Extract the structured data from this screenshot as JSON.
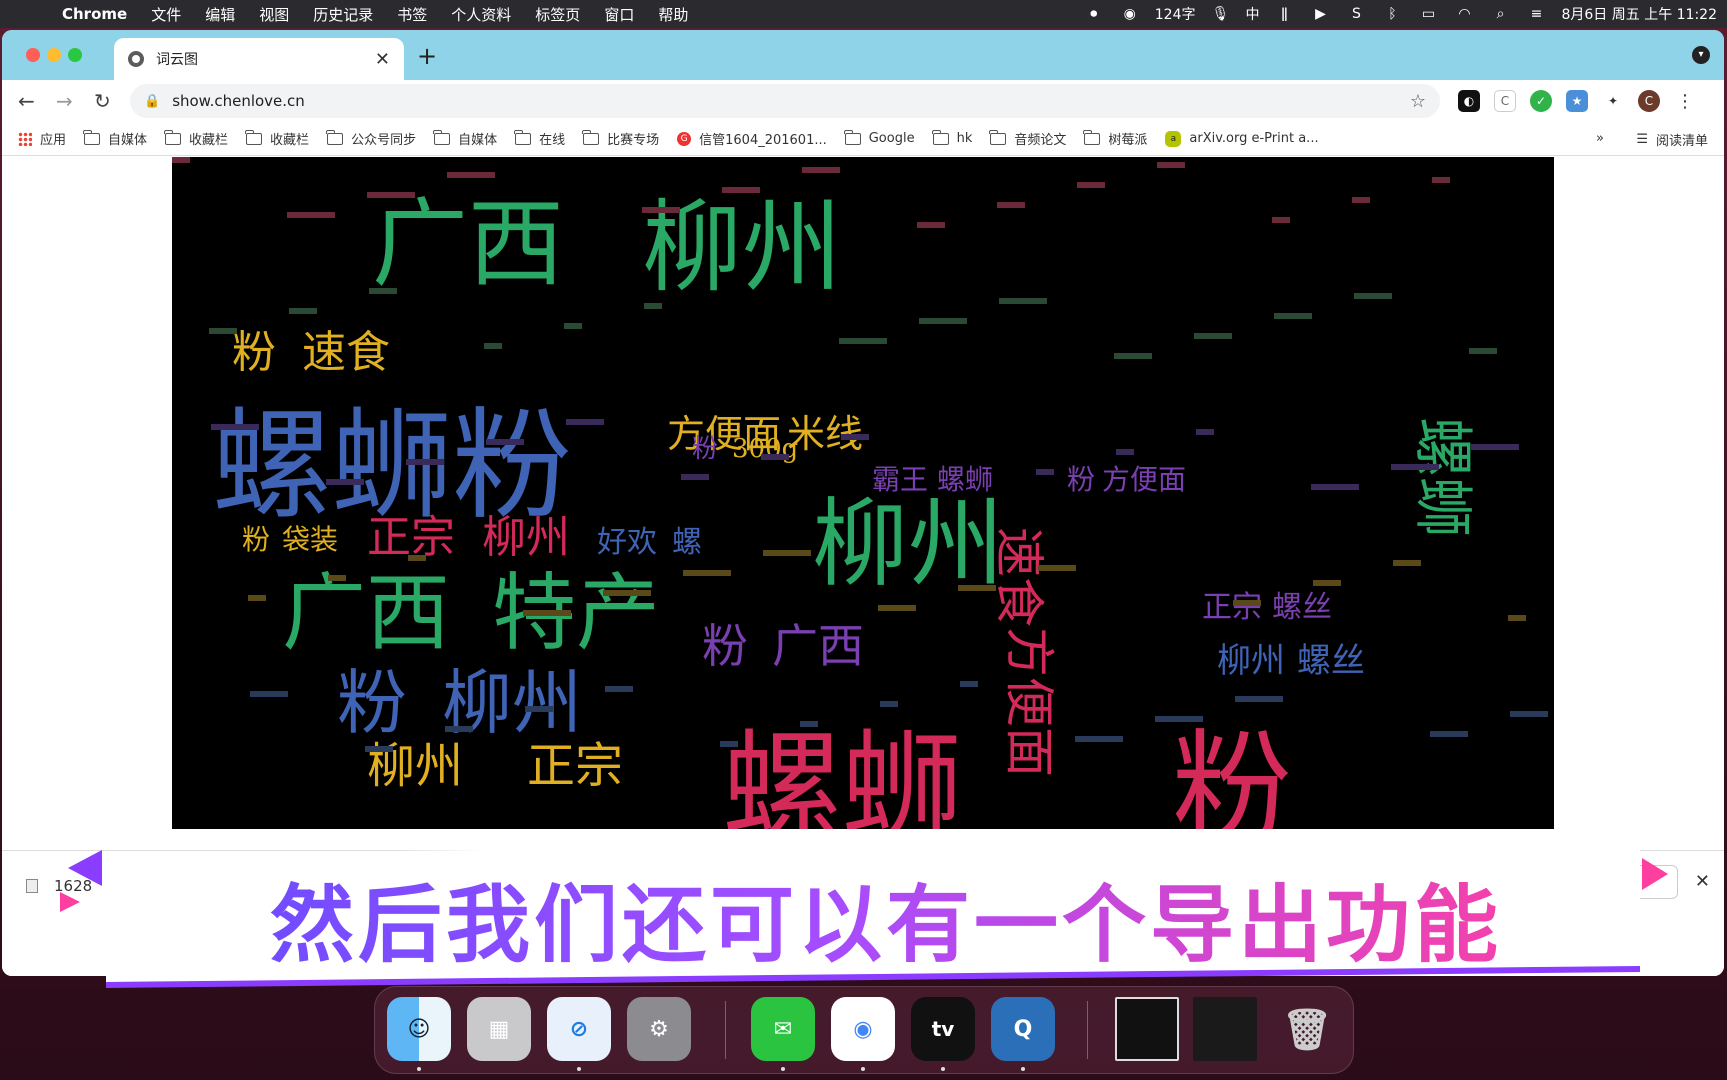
{
  "menubar": {
    "app": "Chrome",
    "items": [
      "文件",
      "编辑",
      "视图",
      "历史记录",
      "书签",
      "个人资料",
      "标签页",
      "窗口",
      "帮助"
    ],
    "status": {
      "word_count": "124字",
      "input_method": "中",
      "datetime": "8月6日 周五 上午 11:22"
    }
  },
  "browser": {
    "tab_title": "词云图",
    "url": "show.chenlove.cn",
    "profile_initial": "C",
    "bookmarks": [
      {
        "label": "应用",
        "type": "apps"
      },
      {
        "label": "自媒体",
        "type": "folder"
      },
      {
        "label": "收藏栏",
        "type": "folder"
      },
      {
        "label": "收藏栏",
        "type": "folder"
      },
      {
        "label": "公众号同步",
        "type": "folder"
      },
      {
        "label": "自媒体",
        "type": "folder"
      },
      {
        "label": "在线",
        "type": "folder"
      },
      {
        "label": "比赛专场",
        "type": "folder"
      },
      {
        "label": "信管1604_201601...",
        "type": "site"
      },
      {
        "label": "Google",
        "type": "folder"
      },
      {
        "label": "hk",
        "type": "folder"
      },
      {
        "label": "音频论文",
        "type": "folder"
      },
      {
        "label": "树莓派",
        "type": "folder"
      },
      {
        "label": "arXiv.org e-Print a...",
        "type": "site"
      }
    ],
    "bookmarks_more": "»",
    "reading_list": "阅读清单"
  },
  "wordcloud": {
    "words": [
      {
        "text": "螺蛳粉",
        "color": "#3f63b5"
      },
      {
        "text": "广西",
        "color": "#2aa866"
      },
      {
        "text": "柳州",
        "color": "#2aa866"
      },
      {
        "text": "螺蛳",
        "color": "#2aa866"
      },
      {
        "text": "柳州",
        "color": "#2aa866"
      },
      {
        "text": "螺蛳",
        "color": "#d42a5a"
      },
      {
        "text": "粉",
        "color": "#d42a5a"
      },
      {
        "text": "广西",
        "color": "#2aa866"
      },
      {
        "text": "特产",
        "color": "#2aa866"
      },
      {
        "text": "方便面",
        "color": "#e0b020"
      },
      {
        "text": "米线",
        "color": "#e0b020"
      },
      {
        "text": "粉",
        "color": "#e0b020"
      },
      {
        "text": "速食",
        "color": "#e0b020"
      },
      {
        "text": "正宗",
        "color": "#d42a5a"
      },
      {
        "text": "柳州",
        "color": "#d42a5a"
      },
      {
        "text": "好欢",
        "color": "#3f63b5"
      },
      {
        "text": "螺",
        "color": "#3f63b5"
      },
      {
        "text": "粉",
        "color": "#3f63b5"
      },
      {
        "text": "柳州",
        "color": "#3f63b5"
      },
      {
        "text": "方便面",
        "color": "#d42a5a"
      },
      {
        "text": "速食",
        "color": "#d42a5a"
      },
      {
        "text": "柳州",
        "color": "#3f63b5"
      },
      {
        "text": "螺丝",
        "color": "#3f63b5"
      },
      {
        "text": "正宗",
        "color": "#7a3fb0"
      },
      {
        "text": "螺丝",
        "color": "#7a3fb0"
      },
      {
        "text": "粉",
        "color": "#7a3fb0"
      },
      {
        "text": "广西",
        "color": "#7a3fb0"
      },
      {
        "text": "霸王",
        "color": "#7a3fb0"
      },
      {
        "text": "螺蛳",
        "color": "#7a3fb0"
      },
      {
        "text": "粉",
        "color": "#7a3fb0"
      },
      {
        "text": "方便面",
        "color": "#7a3fb0"
      },
      {
        "text": "粉",
        "color": "#e0b020"
      },
      {
        "text": "袋装",
        "color": "#e0b020"
      },
      {
        "text": "粉",
        "color": "#7a3fb0"
      },
      {
        "text": "300g",
        "color": "#e0b020"
      },
      {
        "text": "柳州",
        "color": "#e0b020"
      },
      {
        "text": "正宗",
        "color": "#e0b020"
      }
    ]
  },
  "download": {
    "filename": "1628"
  },
  "subtitle": "然后我们还可以有一个导出功能",
  "dock": [
    "finder",
    "launchpad",
    "safari",
    "system-preferences",
    "wechat",
    "chrome",
    "apple-tv",
    "quicktime",
    "wordcloud-window-thumbnail",
    "chrome-window-thumbnail",
    "trash"
  ]
}
